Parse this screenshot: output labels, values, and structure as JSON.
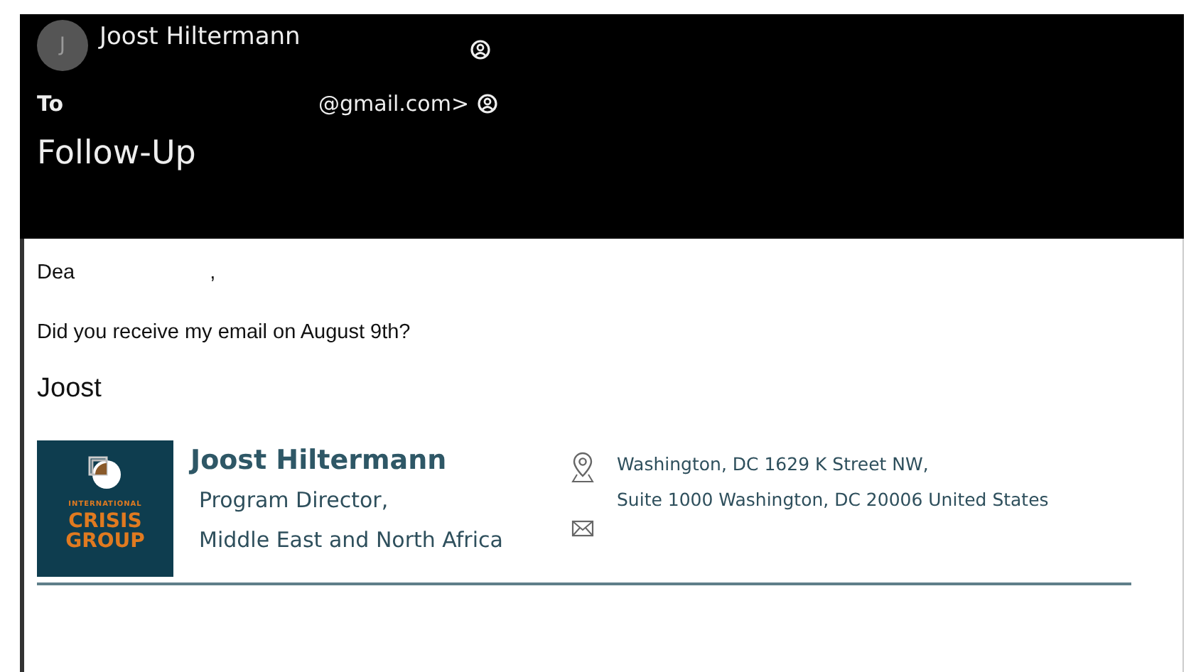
{
  "header": {
    "avatar_initial": "J",
    "sender": "Joost Hiltermann",
    "to_label": "To",
    "recipient": "@gmail.com>",
    "subject": "Follow-Up"
  },
  "body": {
    "greeting": "Dea",
    "greeting_comma": ",",
    "paragraph": "Did you receive my email on August 9th?",
    "signoff": "Joost"
  },
  "signature": {
    "logo_small": "INTERNATIONAL",
    "logo_line_1": "CRISIS",
    "logo_line_2": "GROUP",
    "name": "Joost Hiltermann",
    "title_1": "Program Director,",
    "title_2": "Middle East and North Africa",
    "address_1": "Washington, DC 1629 K Street NW,",
    "address_2": "Suite 1000 Washington, DC 20006 United States"
  }
}
